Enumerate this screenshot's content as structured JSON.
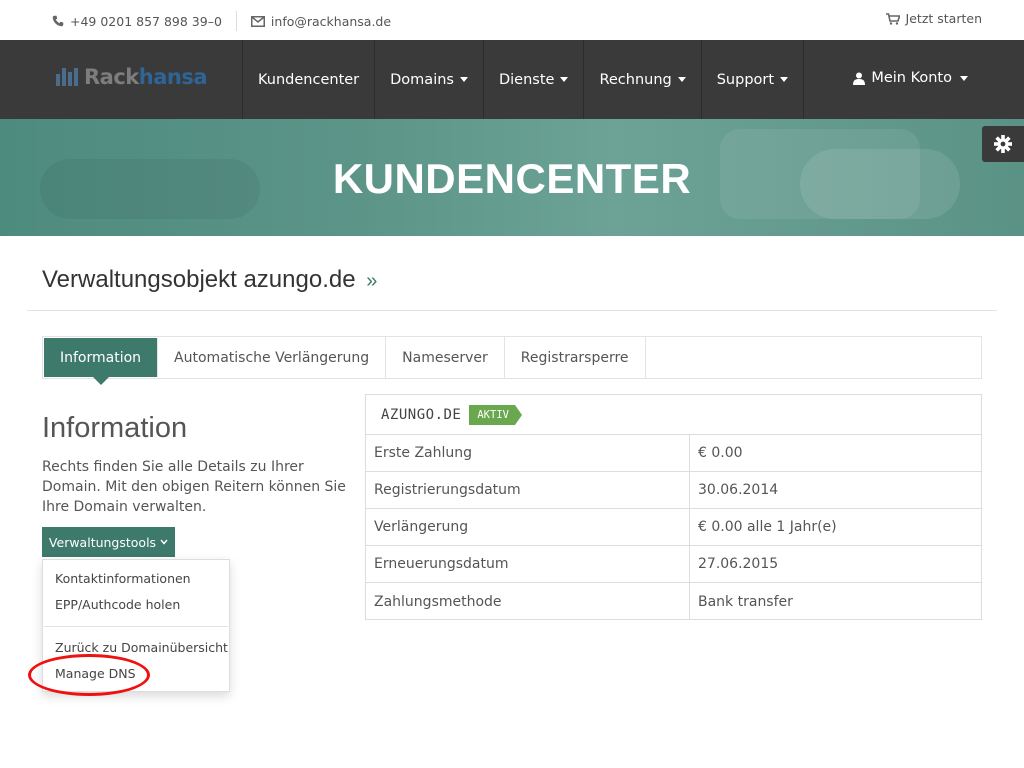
{
  "topbar": {
    "phone": "+49 0201 857 898 39–0",
    "email": "info@rackhansa.de",
    "cart_label": "Jetzt starten"
  },
  "brand": {
    "part1": "Rack",
    "part2": "hansa"
  },
  "nav": {
    "items": [
      {
        "label": "Kundencenter",
        "dropdown": false
      },
      {
        "label": "Domains",
        "dropdown": true
      },
      {
        "label": "Dienste",
        "dropdown": true
      },
      {
        "label": "Rechnung",
        "dropdown": true
      },
      {
        "label": "Support",
        "dropdown": true
      }
    ],
    "account_label": "Mein Konto"
  },
  "banner": {
    "title": "KUNDENCENTER"
  },
  "page": {
    "title": "Verwaltungsobjekt azungo.de",
    "title_suffix": "»"
  },
  "tabs": [
    {
      "label": "Information",
      "active": true
    },
    {
      "label": "Automatische Verlängerung",
      "active": false
    },
    {
      "label": "Nameserver",
      "active": false
    },
    {
      "label": "Registrarsperre",
      "active": false
    }
  ],
  "info": {
    "heading": "Information",
    "text": "Rechts finden Sie alle Details zu Ihrer Domain. Mit den obigen Reitern können Sie Ihre Domain verwalten.",
    "tools_button": "Verwaltungstools",
    "dropdown": [
      "Kontaktinformationen",
      "EPP/Authcode holen",
      "Zurück zu Domainübersicht",
      "Manage DNS"
    ]
  },
  "domain": {
    "name": "AZUNGO.DE",
    "status": "AKTIV",
    "rows": [
      {
        "label": "Erste Zahlung",
        "value": "€ 0.00"
      },
      {
        "label": "Registrierungsdatum",
        "value": "30.06.2014"
      },
      {
        "label": "Verlängerung",
        "value": "€ 0.00 alle 1 Jahr(e)"
      },
      {
        "label": "Erneuerungsdatum",
        "value": "27.06.2015"
      },
      {
        "label": "Zahlungsmethode",
        "value": "Bank transfer"
      }
    ]
  },
  "colors": {
    "accent": "#3d7a6c",
    "nav_bg": "#3a3a3a",
    "badge": "#6aa84f",
    "highlight": "#ee1111"
  }
}
